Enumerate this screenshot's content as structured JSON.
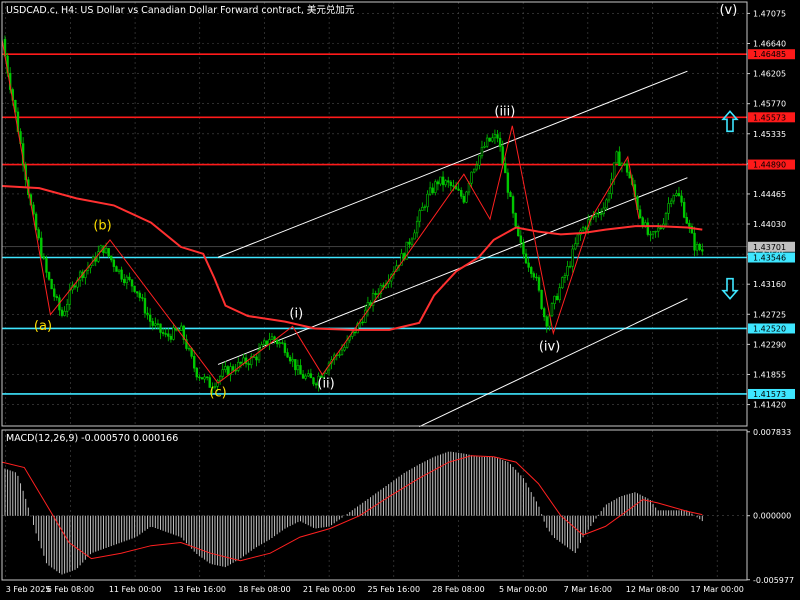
{
  "header": {
    "title": "USDCAD.c, H4:  US Dollar vs Canadian Dollar Forward contract, 美元兑加元"
  },
  "colors": {
    "background": "#000000",
    "grid": "#4a4a4a",
    "candle": "#00c800",
    "ma": "#ff3030",
    "resistance": "#ff1a1a",
    "support": "#3ee6ff",
    "channel": "#ffffff",
    "wave_line": "#ff2020",
    "label_yellow": "#ffe000",
    "label_white": "#ffffff",
    "macd_hist": "#c0c0c0",
    "macd_signal": "#ff2020",
    "arrow": "#3ee6ff"
  },
  "chart_data": [
    {
      "type": "candlestick",
      "title": "USDCAD.c, H4:  US Dollar vs Canadian Dollar Forward contract, 美元兑加元",
      "ylim": [
        1.4111,
        1.4724
      ],
      "y_ticks": [
        "1.47075",
        "1.46640",
        "1.46205",
        "1.45770",
        "1.45335",
        "1.44900",
        "1.44465",
        "1.44030",
        "1.43595",
        "1.43160",
        "1.42725",
        "1.42290",
        "1.41855",
        "1.41420"
      ],
      "x_ticks": [
        "3 Feb 2025",
        "6 Feb 08:00",
        "11 Feb 00:00",
        "13 Feb 16:00",
        "18 Feb 08:00",
        "21 Feb 00:00",
        "25 Feb 16:00",
        "28 Feb 08:00",
        "5 Mar 00:00",
        "7 Mar 16:00",
        "12 Mar 08:00",
        "17 Mar 00:00"
      ],
      "close_path": [
        [
          0,
          1.467
        ],
        [
          0.02,
          1.455
        ],
        [
          0.04,
          1.442
        ],
        [
          0.06,
          1.433
        ],
        [
          0.08,
          1.427
        ],
        [
          0.1,
          1.4325
        ],
        [
          0.12,
          1.4345
        ],
        [
          0.135,
          1.437
        ],
        [
          0.16,
          1.433
        ],
        [
          0.18,
          1.431
        ],
        [
          0.2,
          1.426
        ],
        [
          0.22,
          1.424
        ],
        [
          0.24,
          1.425
        ],
        [
          0.26,
          1.419
        ],
        [
          0.28,
          1.417
        ],
        [
          0.3,
          1.419
        ],
        [
          0.32,
          1.42
        ],
        [
          0.34,
          1.421
        ],
        [
          0.36,
          1.424
        ],
        [
          0.38,
          1.4225
        ],
        [
          0.4,
          1.4185
        ],
        [
          0.42,
          1.4175
        ],
        [
          0.44,
          1.4205
        ],
        [
          0.46,
          1.4225
        ],
        [
          0.48,
          1.426
        ],
        [
          0.5,
          1.43
        ],
        [
          0.52,
          1.433
        ],
        [
          0.54,
          1.436
        ],
        [
          0.555,
          1.44
        ],
        [
          0.57,
          1.444
        ],
        [
          0.585,
          1.4465
        ],
        [
          0.6,
          1.446
        ],
        [
          0.62,
          1.444
        ],
        [
          0.63,
          1.448
        ],
        [
          0.65,
          1.452
        ],
        [
          0.665,
          1.453
        ],
        [
          0.68,
          1.445
        ],
        [
          0.69,
          1.439
        ],
        [
          0.7,
          1.436
        ],
        [
          0.715,
          1.433
        ],
        [
          0.73,
          1.426
        ],
        [
          0.745,
          1.43
        ],
        [
          0.76,
          1.434
        ],
        [
          0.775,
          1.439
        ],
        [
          0.79,
          1.441
        ],
        [
          0.81,
          1.443
        ],
        [
          0.825,
          1.45
        ],
        [
          0.84,
          1.448
        ],
        [
          0.855,
          1.442
        ],
        [
          0.87,
          1.438
        ],
        [
          0.885,
          1.44
        ],
        [
          0.9,
          1.445
        ],
        [
          0.91,
          1.444
        ],
        [
          0.93,
          1.437
        ],
        [
          0.94,
          1.4365
        ]
      ],
      "current_price": "1.43701",
      "moving_average_path": [
        [
          0,
          1.4458
        ],
        [
          0.05,
          1.4455
        ],
        [
          0.1,
          1.444
        ],
        [
          0.15,
          1.443
        ],
        [
          0.2,
          1.4405
        ],
        [
          0.24,
          1.437
        ],
        [
          0.27,
          1.436
        ],
        [
          0.285,
          1.4325
        ],
        [
          0.3,
          1.4285
        ],
        [
          0.33,
          1.427
        ],
        [
          0.38,
          1.4262
        ],
        [
          0.42,
          1.4252
        ],
        [
          0.47,
          1.425
        ],
        [
          0.52,
          1.425
        ],
        [
          0.56,
          1.426
        ],
        [
          0.58,
          1.43
        ],
        [
          0.61,
          1.4335
        ],
        [
          0.64,
          1.4355
        ],
        [
          0.66,
          1.438
        ],
        [
          0.69,
          1.4398
        ],
        [
          0.72,
          1.4392
        ],
        [
          0.75,
          1.4388
        ],
        [
          0.78,
          1.439
        ],
        [
          0.81,
          1.4395
        ],
        [
          0.85,
          1.44
        ],
        [
          0.88,
          1.44
        ],
        [
          0.92,
          1.4398
        ],
        [
          0.94,
          1.4395
        ]
      ],
      "horizontal_levels": [
        {
          "label": "1.46485",
          "value": 1.46485,
          "kind": "resistance"
        },
        {
          "label": "1.45573",
          "value": 1.45573,
          "kind": "resistance"
        },
        {
          "label": "1.44890",
          "value": 1.4489,
          "kind": "resistance"
        },
        {
          "label": "1.43546",
          "value": 1.43546,
          "kind": "support"
        },
        {
          "label": "1.42520",
          "value": 1.4252,
          "kind": "support"
        },
        {
          "label": "1.41573",
          "value": 1.41573,
          "kind": "support"
        }
      ],
      "channel_lines": [
        [
          [
            0.29,
            1.4355
          ],
          [
            0.92,
            1.4624
          ]
        ],
        [
          [
            0.29,
            1.42
          ],
          [
            0.92,
            1.447
          ]
        ],
        [
          [
            0.56,
            1.411
          ],
          [
            0.92,
            1.4295
          ]
        ]
      ],
      "wave_path": [
        [
          0.0,
          1.467
        ],
        [
          0.065,
          1.4272
        ],
        [
          0.145,
          1.438
        ],
        [
          0.29,
          1.4173
        ],
        [
          0.39,
          1.4255
        ],
        [
          0.43,
          1.4185
        ],
        [
          0.62,
          1.4475
        ],
        [
          0.655,
          1.441
        ],
        [
          0.685,
          1.4545
        ],
        [
          0.74,
          1.4245
        ],
        [
          0.79,
          1.441
        ],
        [
          0.84,
          1.45
        ],
        [
          0.855,
          1.441
        ]
      ],
      "wave_labels": [
        {
          "text": "(a)",
          "x": 0.055,
          "y": 1.425,
          "color": "yellow"
        },
        {
          "text": "(b)",
          "x": 0.135,
          "y": 1.4395,
          "color": "yellow"
        },
        {
          "text": "(c)",
          "x": 0.29,
          "y": 1.4154,
          "color": "yellow"
        },
        {
          "text": "(i)",
          "x": 0.395,
          "y": 1.4268,
          "color": "white"
        },
        {
          "text": "(ii)",
          "x": 0.435,
          "y": 1.4167,
          "color": "white"
        },
        {
          "text": "(iii)",
          "x": 0.675,
          "y": 1.456,
          "color": "white"
        },
        {
          "text": "(iv)",
          "x": 0.735,
          "y": 1.422,
          "color": "white"
        },
        {
          "text": "(v)",
          "x": 0.975,
          "y": 1.4707,
          "color": "white"
        }
      ],
      "arrows": [
        {
          "direction": "up",
          "y": 1.455
        },
        {
          "direction": "down",
          "y": 1.4311
        }
      ]
    },
    {
      "type": "bar",
      "title": "MACD(12,26,9) -0.000570 0.000166",
      "ylim": [
        -0.006,
        0.008
      ],
      "y_ticks": [
        "0.007833",
        "0.000000",
        "-0.005977"
      ],
      "histogram_path": [
        [
          0,
          0.0045
        ],
        [
          0.02,
          0.004
        ],
        [
          0.03,
          0.002
        ],
        [
          0.045,
          -0.0015
        ],
        [
          0.06,
          -0.0045
        ],
        [
          0.08,
          -0.0055
        ],
        [
          0.1,
          -0.005
        ],
        [
          0.12,
          -0.0035
        ],
        [
          0.14,
          -0.003
        ],
        [
          0.16,
          -0.0025
        ],
        [
          0.18,
          -0.002
        ],
        [
          0.2,
          -0.001
        ],
        [
          0.22,
          -0.0015
        ],
        [
          0.24,
          -0.002
        ],
        [
          0.26,
          -0.0035
        ],
        [
          0.28,
          -0.0045
        ],
        [
          0.3,
          -0.0048
        ],
        [
          0.32,
          -0.004
        ],
        [
          0.34,
          -0.003
        ],
        [
          0.36,
          -0.0022
        ],
        [
          0.38,
          -0.0012
        ],
        [
          0.4,
          -0.0005
        ],
        [
          0.42,
          -0.0012
        ],
        [
          0.44,
          -0.001
        ],
        [
          0.46,
          0.0
        ],
        [
          0.48,
          0.001
        ],
        [
          0.5,
          0.002
        ],
        [
          0.52,
          0.003
        ],
        [
          0.54,
          0.004
        ],
        [
          0.56,
          0.0048
        ],
        [
          0.58,
          0.0055
        ],
        [
          0.6,
          0.006
        ],
        [
          0.62,
          0.0058
        ],
        [
          0.64,
          0.0055
        ],
        [
          0.66,
          0.0055
        ],
        [
          0.68,
          0.005
        ],
        [
          0.7,
          0.0035
        ],
        [
          0.72,
          0.001
        ],
        [
          0.73,
          -0.001
        ],
        [
          0.74,
          -0.002
        ],
        [
          0.76,
          -0.003
        ],
        [
          0.77,
          -0.0035
        ],
        [
          0.78,
          -0.002
        ],
        [
          0.8,
          0.0
        ],
        [
          0.81,
          0.001
        ],
        [
          0.83,
          0.0018
        ],
        [
          0.85,
          0.0022
        ],
        [
          0.87,
          0.0015
        ],
        [
          0.88,
          0.0005
        ],
        [
          0.9,
          0.0005
        ],
        [
          0.92,
          0.0005
        ],
        [
          0.94,
          -0.0005
        ]
      ],
      "signal_path": [
        [
          0,
          0.005
        ],
        [
          0.03,
          0.0045
        ],
        [
          0.06,
          0.001
        ],
        [
          0.09,
          -0.0025
        ],
        [
          0.12,
          -0.004
        ],
        [
          0.16,
          -0.0035
        ],
        [
          0.2,
          -0.0028
        ],
        [
          0.24,
          -0.0025
        ],
        [
          0.28,
          -0.0035
        ],
        [
          0.32,
          -0.0042
        ],
        [
          0.36,
          -0.0035
        ],
        [
          0.4,
          -0.002
        ],
        [
          0.44,
          -0.0012
        ],
        [
          0.48,
          0.0
        ],
        [
          0.52,
          0.0018
        ],
        [
          0.56,
          0.0035
        ],
        [
          0.6,
          0.005
        ],
        [
          0.63,
          0.0056
        ],
        [
          0.66,
          0.0055
        ],
        [
          0.69,
          0.005
        ],
        [
          0.72,
          0.003
        ],
        [
          0.75,
          0.0
        ],
        [
          0.78,
          -0.0018
        ],
        [
          0.81,
          -0.001
        ],
        [
          0.84,
          0.0005
        ],
        [
          0.86,
          0.0015
        ],
        [
          0.88,
          0.0012
        ],
        [
          0.9,
          0.0008
        ],
        [
          0.92,
          0.0004
        ],
        [
          0.94,
          0.0001
        ]
      ]
    }
  ]
}
